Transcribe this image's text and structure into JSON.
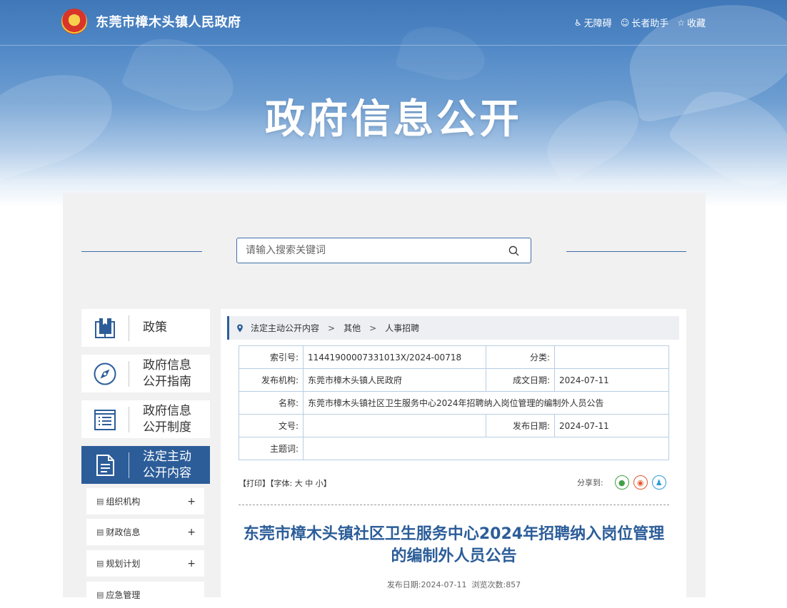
{
  "header": {
    "site_title": "东莞市樟木头镇人民政府",
    "links": [
      {
        "label": "无障碍",
        "icon": "accessibility-icon"
      },
      {
        "label": "长者助手",
        "icon": "elder-icon"
      },
      {
        "label": "收藏",
        "icon": "star-icon"
      }
    ],
    "hero_title": "政府信息公开"
  },
  "search": {
    "placeholder": "请输入搜索关键词"
  },
  "sidebar": {
    "items": [
      {
        "label": "政策",
        "icon": "book-icon"
      },
      {
        "label1": "政府信息",
        "label2": "公开指南",
        "icon": "compass-icon"
      },
      {
        "label1": "政府信息",
        "label2": "公开制度",
        "icon": "list-icon"
      },
      {
        "label1": "法定主动",
        "label2": "公开内容",
        "icon": "document-icon",
        "active": true
      }
    ],
    "sub_items": [
      {
        "label": "组织机构",
        "toggle": "+"
      },
      {
        "label": "财政信息",
        "toggle": "+"
      },
      {
        "label": "规划计划",
        "toggle": "+"
      },
      {
        "label": "应急管理"
      }
    ]
  },
  "breadcrumb": {
    "items": [
      "法定主动公开内容",
      "其他",
      "人事招聘"
    ],
    "separator": ">"
  },
  "meta": {
    "index_no_label": "索引号:",
    "index_no": "11441900007331013X/2024-00718",
    "category_label": "分类:",
    "category": "",
    "publisher_label": "发布机构:",
    "publisher": "东莞市樟木头镇人民政府",
    "created_label": "成文日期:",
    "created": "2024-07-11",
    "name_label": "名称:",
    "name": "东莞市樟木头镇社区卫生服务中心2024年招聘纳入岗位管理的编制外人员公告",
    "doc_no_label": "文号:",
    "doc_no": "",
    "published_label": "发布日期:",
    "published": "2024-07-11",
    "keywords_label": "主题词:",
    "keywords": ""
  },
  "tools": {
    "print": "【打印】",
    "font_prefix": "【字体:",
    "font_large": "大",
    "font_medium": "中",
    "font_small": "小",
    "font_suffix": "】"
  },
  "share": {
    "label": "分享到:",
    "items": [
      "wechat-icon",
      "weibo-icon",
      "qq-icon"
    ]
  },
  "article": {
    "title": "东莞市樟木头镇社区卫生服务中心2024年招聘纳入岗位管理的编制外人员公告",
    "date_label": "发布日期:",
    "date": "2024-07-11",
    "views_label": "浏览次数:",
    "views": "857"
  },
  "colors": {
    "primary": "#2c5d99",
    "panel_bg": "#f1f1f1",
    "table_border": "#b8cde4"
  }
}
